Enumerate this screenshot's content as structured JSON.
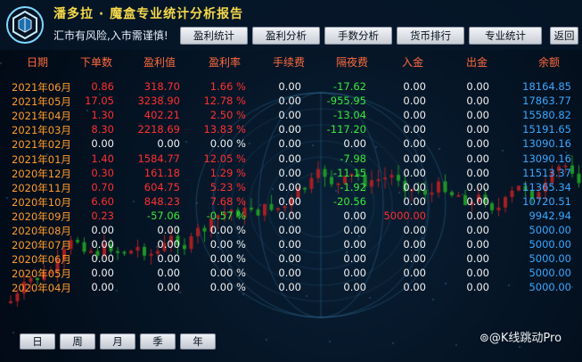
{
  "app": {
    "title": "潘多拉 · 魔盒专业统计分析报告",
    "subtitle": "汇市有风险,入市需谨慎!"
  },
  "tabs": [
    "盈利统计",
    "盈利分析",
    "手数分析",
    "货币排行",
    "专业统计"
  ],
  "back_label": "返回",
  "columns": [
    "日期",
    "下单数",
    "盈利值",
    "盈利率",
    "手续费",
    "隔夜费",
    "入金",
    "出金",
    "余额"
  ],
  "rows": [
    {
      "date": "2021年06月",
      "orders": "0.86",
      "profit": "318.70",
      "rate": "1.66 %",
      "fee": "0.00",
      "swap": "-17.62",
      "deposit": "0.00",
      "withdraw": "0.00",
      "balance": "18164.85"
    },
    {
      "date": "2021年05月",
      "orders": "17.05",
      "profit": "3238.90",
      "rate": "12.78 %",
      "fee": "0.00",
      "swap": "-955.95",
      "deposit": "0.00",
      "withdraw": "0.00",
      "balance": "17863.77"
    },
    {
      "date": "2021年04月",
      "orders": "1.30",
      "profit": "402.21",
      "rate": "2.50 %",
      "fee": "0.00",
      "swap": "-13.04",
      "deposit": "0.00",
      "withdraw": "0.00",
      "balance": "15580.82"
    },
    {
      "date": "2021年03月",
      "orders": "8.30",
      "profit": "2218.69",
      "rate": "13.83 %",
      "fee": "0.00",
      "swap": "-117.20",
      "deposit": "0.00",
      "withdraw": "0.00",
      "balance": "15191.65"
    },
    {
      "date": "2021年02月",
      "orders": "0.00",
      "profit": "0.00",
      "rate": "0.00 %",
      "fee": "0.00",
      "swap": "0.00",
      "deposit": "0.00",
      "withdraw": "0.00",
      "balance": "13090.16"
    },
    {
      "date": "2021年01月",
      "orders": "1.40",
      "profit": "1584.77",
      "rate": "12.05 %",
      "fee": "0.00",
      "swap": "-7.98",
      "deposit": "0.00",
      "withdraw": "0.00",
      "balance": "13090.16"
    },
    {
      "date": "2020年12月",
      "orders": "0.30",
      "profit": "161.18",
      "rate": "1.29 %",
      "fee": "0.00",
      "swap": "-11.15",
      "deposit": "0.00",
      "withdraw": "0.00",
      "balance": "11513.37"
    },
    {
      "date": "2020年11月",
      "orders": "0.70",
      "profit": "604.75",
      "rate": "5.23 %",
      "fee": "0.00",
      "swap": "-1.92",
      "deposit": "0.00",
      "withdraw": "0.00",
      "balance": "11365.34"
    },
    {
      "date": "2020年10月",
      "orders": "6.60",
      "profit": "848.23",
      "rate": "7.68 %",
      "fee": "0.00",
      "swap": "-20.56",
      "deposit": "0.00",
      "withdraw": "0.00",
      "balance": "10720.51"
    },
    {
      "date": "2020年09月",
      "orders": "0.23",
      "profit": "-57.06",
      "rate": "-0.57 %",
      "fee": "0.00",
      "swap": "0.00",
      "deposit": "5000.00",
      "withdraw": "0.00",
      "balance": "9942.94"
    },
    {
      "date": "2020年08月",
      "orders": "0.00",
      "profit": "0.00",
      "rate": "0.00 %",
      "fee": "0.00",
      "swap": "0.00",
      "deposit": "0.00",
      "withdraw": "0.00",
      "balance": "5000.00"
    },
    {
      "date": "2020年07月",
      "orders": "0.00",
      "profit": "0.00",
      "rate": "0.00 %",
      "fee": "0.00",
      "swap": "0.00",
      "deposit": "0.00",
      "withdraw": "0.00",
      "balance": "5000.00"
    },
    {
      "date": "2020年06月",
      "orders": "0.00",
      "profit": "0.00",
      "rate": "0.00 %",
      "fee": "0.00",
      "swap": "0.00",
      "deposit": "0.00",
      "withdraw": "0.00",
      "balance": "5000.00"
    },
    {
      "date": "2020年05月",
      "orders": "0.00",
      "profit": "0.00",
      "rate": "0.00 %",
      "fee": "0.00",
      "swap": "0.00",
      "deposit": "0.00",
      "withdraw": "0.00",
      "balance": "5000.00"
    },
    {
      "date": "2020年04月",
      "orders": "0.00",
      "profit": "0.00",
      "rate": "0.00 %",
      "fee": "0.00",
      "swap": "0.00",
      "deposit": "0.00",
      "withdraw": "0.00",
      "balance": "5000.00"
    }
  ],
  "period_tabs": [
    "日",
    "周",
    "月",
    "季",
    "年"
  ],
  "watermark": "@K线跳动Pro",
  "colors": {
    "background": "#04101f",
    "header_text": "#ff6a3d",
    "date": "#ff9a2a",
    "positive": "#ff3030",
    "negative": "#39e83b",
    "balance": "#39a7ff",
    "title": "#f5d84a"
  },
  "icons": {
    "logo": "hex-cube-logo-icon",
    "watermark": "weibo-icon"
  }
}
